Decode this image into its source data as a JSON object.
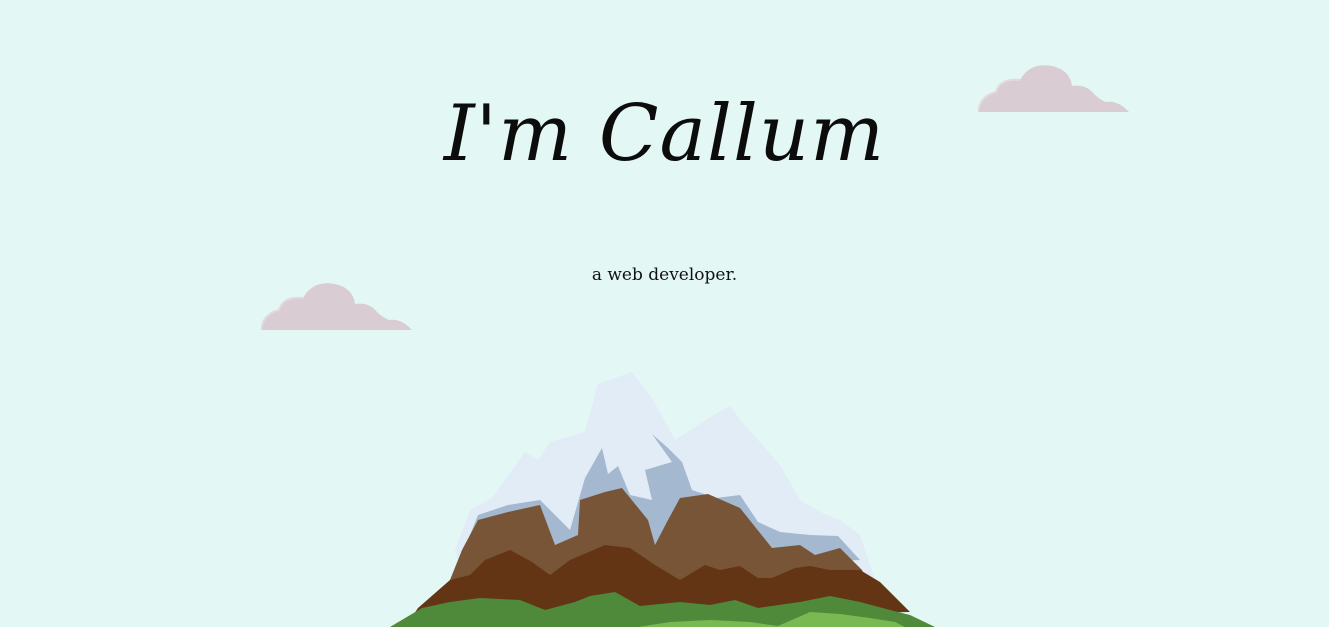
{
  "hero": {
    "title": "I'm Callum",
    "subtitle": "a web developer."
  },
  "colors": {
    "background": "#e3f7f4",
    "cloud": "#d9ccd2",
    "snow": "#e1ecf7",
    "snow_shadow": "#a4b8cf",
    "rock_light": "#795538",
    "rock_dark": "#643515",
    "grass_dark": "#4f8a3b",
    "grass_light": "#7ab852"
  }
}
